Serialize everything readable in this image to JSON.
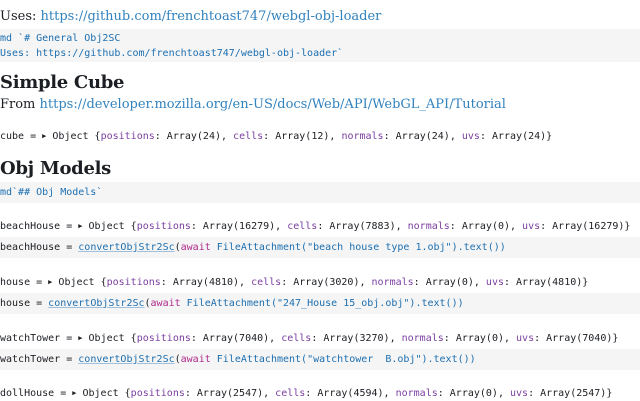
{
  "uses_prefix": "Uses:",
  "uses_link": "https://github.com/frenchtoast747/webgl-obj-loader",
  "md1": {
    "line1": "md `# General Obj2SC",
    "line2": "Uses: https://github.com/frenchtoast747/webgl-obj-loader`"
  },
  "simple_cube": {
    "heading": "Simple Cube",
    "from_prefix": "From",
    "from_link": "https://developer.mozilla.org/en-US/docs/Web/API/WebGL_API/Tutorial",
    "cube_out": {
      "var": "cube = ",
      "obj": "Object {",
      "p1": "positions",
      "v1": ": Array(24), ",
      "p2": "cells",
      "v2": ": Array(12), ",
      "p3": "normals",
      "v3": ": Array(24), ",
      "p4": "uvs",
      "v4": ": Array(24)}"
    }
  },
  "obj_models": {
    "heading": "Obj Models",
    "md": "md`## Obj Models`"
  },
  "models": [
    {
      "out": {
        "var": "beachHouse = ",
        "v1": ": Array(16279), ",
        "v2": ": Array(7883), ",
        "v3": ": Array(0), ",
        "v4": ": Array(16279)}"
      },
      "code": {
        "var": "beachHouse = ",
        "fn": "convertObjStr2Sc",
        "open": "(",
        "await": "await",
        "call": " FileAttachment(",
        "str": "\"beach house type 1.obj\"",
        "tail": ").text())"
      }
    },
    {
      "out": {
        "var": "house = ",
        "v1": ": Array(4810), ",
        "v2": ": Array(3020), ",
        "v3": ": Array(0), ",
        "v4": ": Array(4810)}"
      },
      "code": {
        "var": "house = ",
        "fn": "convertObjStr2Sc",
        "open": "(",
        "await": "await",
        "call": " FileAttachment(",
        "str": "\"247_House 15_obj.obj\"",
        "tail": ").text())"
      }
    },
    {
      "out": {
        "var": "watchTower = ",
        "v1": ": Array(7040), ",
        "v2": ": Array(3270), ",
        "v3": ": Array(0), ",
        "v4": ": Array(7040)}"
      },
      "code": {
        "var": "watchTower = ",
        "fn": "convertObjStr2Sc",
        "open": "(",
        "await": "await",
        "call": " FileAttachment(",
        "str": "\"watchtower  B.obj\"",
        "tail": ").text())"
      }
    },
    {
      "out": {
        "var": "dollHouse = ",
        "v1": ": Array(2547), ",
        "v2": ": Array(4594), ",
        "v3": ": Array(0), ",
        "v4": ": Array(2547)}"
      }
    }
  ],
  "labels": {
    "obj": "Object {",
    "p1": "positions",
    "p2": "cells",
    "p3": "normals",
    "p4": "uvs"
  }
}
